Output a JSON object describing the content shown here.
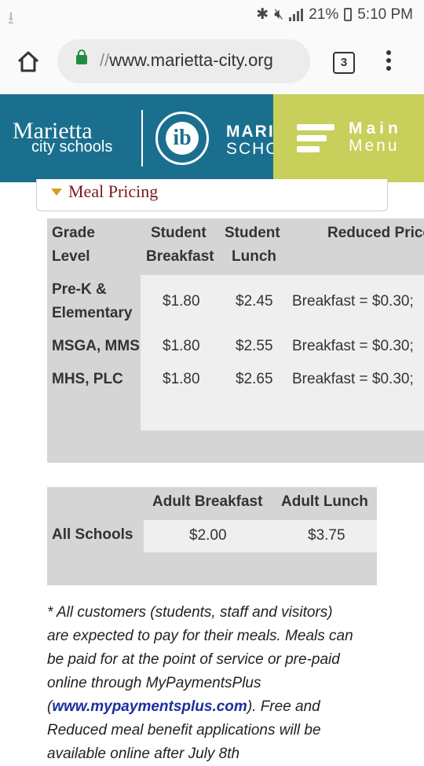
{
  "status_bar": {
    "battery": "21%",
    "time": "5:10 PM"
  },
  "browser": {
    "url_prefix": "//",
    "url": "www.marietta-city.org",
    "tab_count": "3"
  },
  "header": {
    "brand_line1": "Marietta",
    "brand_line2": "city schools",
    "ib_label": "ib",
    "school_line1": "MARI",
    "school_line2": "SCHO",
    "menu_line1": "Main",
    "menu_line2": "Menu",
    "colors": {
      "blue": "#1a6f8e",
      "green": "#c8cf5a"
    }
  },
  "section": {
    "title": "Meal Pricing"
  },
  "student_table": {
    "headers": {
      "grade_1": "Grade",
      "grade_2": "Level",
      "sb_1": "Student",
      "sb_2": "Breakfast",
      "sl_1": "Student",
      "sl_2": "Lunch",
      "reduced": "Reduced Price"
    },
    "rows": [
      {
        "grade_1": "Pre-K &",
        "grade_2": "Elementary",
        "breakfast": "$1.80",
        "lunch": "$2.45",
        "reduced": "Breakfast = $0.30;"
      },
      {
        "grade_1": "MSGA, MMS",
        "breakfast": "$1.80",
        "lunch": "$2.55",
        "reduced": "Breakfast = $0.30;"
      },
      {
        "grade_1": "MHS, PLC",
        "breakfast": "$1.80",
        "lunch": "$2.65",
        "reduced": "Breakfast = $0.30;"
      }
    ]
  },
  "adult_table": {
    "headers": {
      "breakfast": "Adult Breakfast",
      "lunch": "Adult Lunch"
    },
    "row": {
      "label": "All Schools",
      "breakfast": "$2.00",
      "lunch": "$3.75"
    }
  },
  "note": {
    "line1": "* All customers (students, staff and visitors)",
    "line2": "are expected to pay for their meals. Meals can",
    "line3": "be paid for at the point of service or pre-paid",
    "line4": "online through MyPaymentsPlus",
    "line5_open": "(",
    "link": "www.mypaymentsplus.com",
    "line5_close": ").  Free and",
    "line6": "Reduced meal benefit applications will be",
    "line7": "available online after July 8th"
  }
}
